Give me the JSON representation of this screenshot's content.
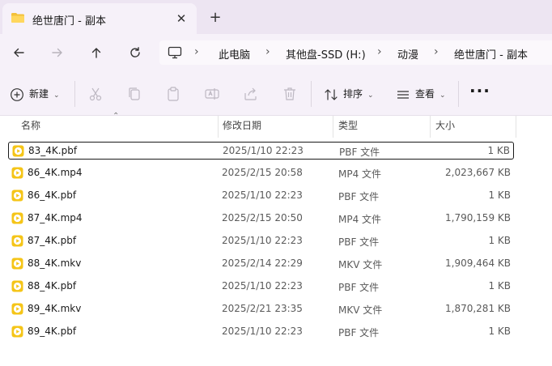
{
  "tab": {
    "title": "绝世唐门 - 副本",
    "close_label": "✕",
    "new_tab_label": "+"
  },
  "nav": {
    "breadcrumbs": [
      "此电脑",
      "其他盘-SSD (H:)",
      "动漫",
      "绝世唐门 - 副本"
    ],
    "separator": "›"
  },
  "toolbar": {
    "new_label": "新建",
    "sort_label": "排序",
    "view_label": "查看",
    "more_label": "···"
  },
  "columns": {
    "name": "名称",
    "modified": "修改日期",
    "type": "类型",
    "size": "大小"
  },
  "files": [
    {
      "name": "83_4K.pbf",
      "modified": "2025/1/10 22:23",
      "type": "PBF 文件",
      "size": "1 KB",
      "selected": true
    },
    {
      "name": "86_4K.mp4",
      "modified": "2025/2/15 20:58",
      "type": "MP4 文件",
      "size": "2,023,667 KB"
    },
    {
      "name": "86_4K.pbf",
      "modified": "2025/1/10 22:23",
      "type": "PBF 文件",
      "size": "1 KB"
    },
    {
      "name": "87_4K.mp4",
      "modified": "2025/2/15 20:50",
      "type": "MP4 文件",
      "size": "1,790,159 KB"
    },
    {
      "name": "87_4K.pbf",
      "modified": "2025/1/10 22:23",
      "type": "PBF 文件",
      "size": "1 KB"
    },
    {
      "name": "88_4K.mkv",
      "modified": "2025/2/14 22:29",
      "type": "MKV 文件",
      "size": "1,909,464 KB"
    },
    {
      "name": "88_4K.pbf",
      "modified": "2025/1/10 22:23",
      "type": "PBF 文件",
      "size": "1 KB"
    },
    {
      "name": "89_4K.mkv",
      "modified": "2025/2/21 23:35",
      "type": "MKV 文件",
      "size": "1,870,281 KB"
    },
    {
      "name": "89_4K.pbf",
      "modified": "2025/1/10 22:23",
      "type": "PBF 文件",
      "size": "1 KB"
    }
  ],
  "colors": {
    "accent": "#f5c518",
    "chrome": "#f6f1f9",
    "tabstrip": "#ede5f2"
  }
}
